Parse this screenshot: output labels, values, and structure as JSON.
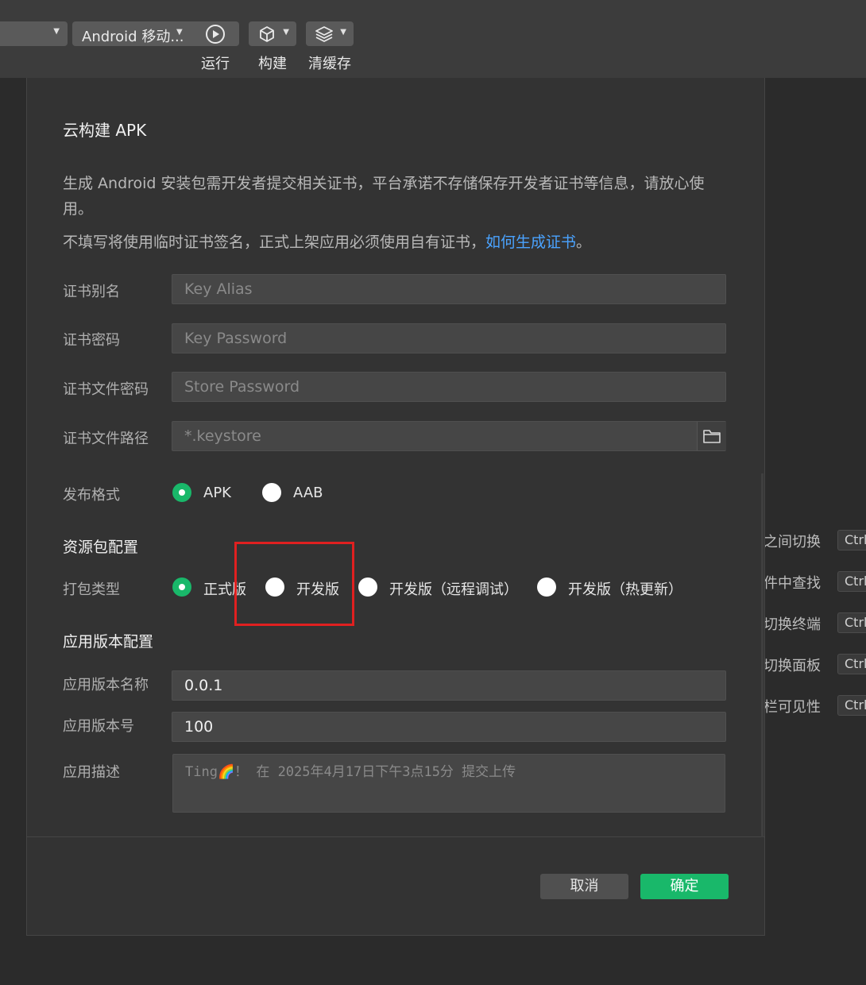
{
  "toolbar": {
    "device_select": "",
    "platform_select": "Android 移动...",
    "run_label": "运行",
    "build_label": "构建",
    "clear_cache_label": "清缓存"
  },
  "dialog": {
    "title": "云构建 APK",
    "info_line1": "生成 Android 安装包需开发者提交相关证书，平台承诺不存储保存开发者证书等信息，请放心使",
    "info_line1b": "用。",
    "info_line2": "不填写将使用临时证书签名，正式上架应用必须使用自有证书，",
    "info_link": "如何生成证书",
    "info_line2_end": "。",
    "fields": {
      "key_alias": {
        "label": "证书别名",
        "placeholder": "Key Alias"
      },
      "key_password": {
        "label": "证书密码",
        "placeholder": "Key Password"
      },
      "store_password": {
        "label": "证书文件密码",
        "placeholder": "Store Password"
      },
      "keystore_path": {
        "label": "证书文件路径",
        "placeholder": "*.keystore"
      }
    },
    "publish_format": {
      "label": "发布格式",
      "options": [
        "APK",
        "AAB"
      ],
      "selected": "APK"
    },
    "resource_section": "资源包配置",
    "package_type": {
      "label": "打包类型",
      "options": [
        "正式版",
        "开发版",
        "开发版（远程调试）",
        "开发版（热更新）"
      ],
      "selected": "正式版"
    },
    "version_section": "应用版本配置",
    "version_name": {
      "label": "应用版本名称",
      "value": "0.0.1"
    },
    "version_code": {
      "label": "应用版本号",
      "value": "100"
    },
    "description": {
      "label": "应用描述",
      "placeholder": "Ting🌈！ 在 2025年4月17日下午3点15分 提交上传"
    },
    "cancel_label": "取消",
    "confirm_label": "确定"
  },
  "side_hints": [
    {
      "text": "之间切换",
      "key": "Ctrl"
    },
    {
      "text": "件中查找",
      "key": "Ctrl"
    },
    {
      "text": "切换终端",
      "key": "Ctrl"
    },
    {
      "text": "切换面板",
      "key": "Ctrl"
    },
    {
      "text": "栏可见性",
      "key": "Ctrl"
    }
  ],
  "colors": {
    "accent_green": "#19b86a",
    "link_blue": "#4aa3ff",
    "highlight_red": "#e02020"
  }
}
